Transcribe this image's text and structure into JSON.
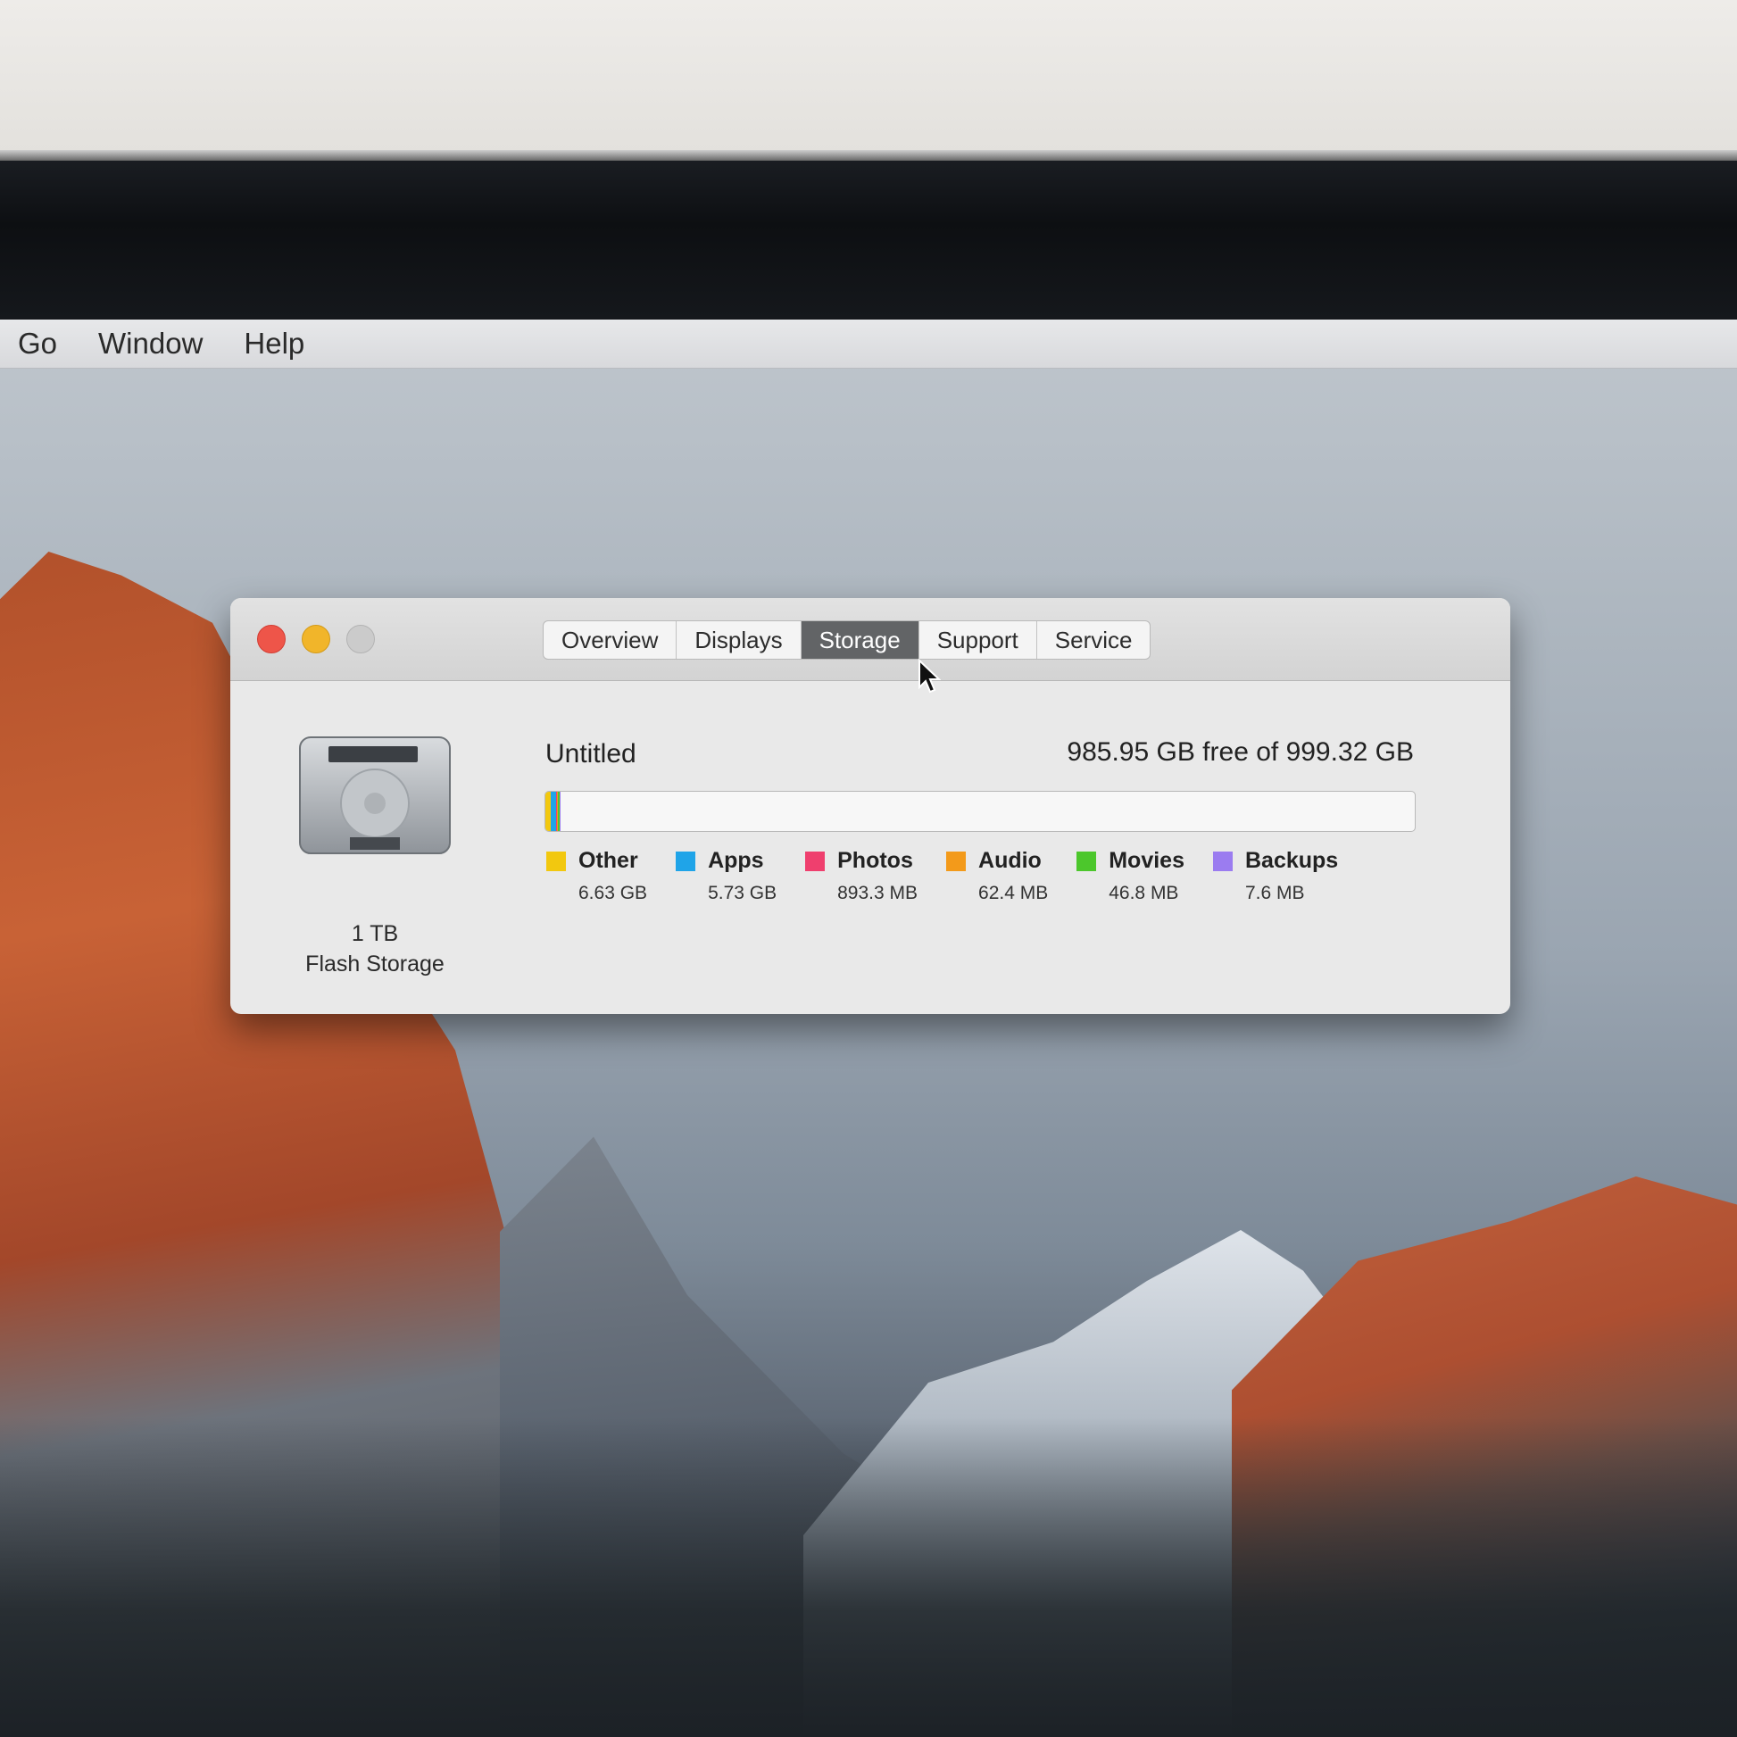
{
  "menu": {
    "items": [
      "Go",
      "Window",
      "Help"
    ]
  },
  "window": {
    "tabs": [
      "Overview",
      "Displays",
      "Storage",
      "Support",
      "Service"
    ],
    "active_tab": "Storage",
    "drive": {
      "capacity": "1 TB",
      "type": "Flash Storage"
    },
    "volume": {
      "name": "Untitled",
      "free_text": "985.95 GB free of 999.32 GB"
    },
    "categories": [
      {
        "name": "Other",
        "size": "6.63 GB",
        "color": "#f2c80f"
      },
      {
        "name": "Apps",
        "size": "5.73 GB",
        "color": "#1fa4e8"
      },
      {
        "name": "Photos",
        "size": "893.3 MB",
        "color": "#ef3f6e"
      },
      {
        "name": "Audio",
        "size": "62.4 MB",
        "color": "#f39a1a"
      },
      {
        "name": "Movies",
        "size": "46.8 MB",
        "color": "#4cc72c"
      },
      {
        "name": "Backups",
        "size": "7.6 MB",
        "color": "#9b7cf0"
      }
    ],
    "usage_bar": {
      "used_fraction": 0.0134
    }
  }
}
